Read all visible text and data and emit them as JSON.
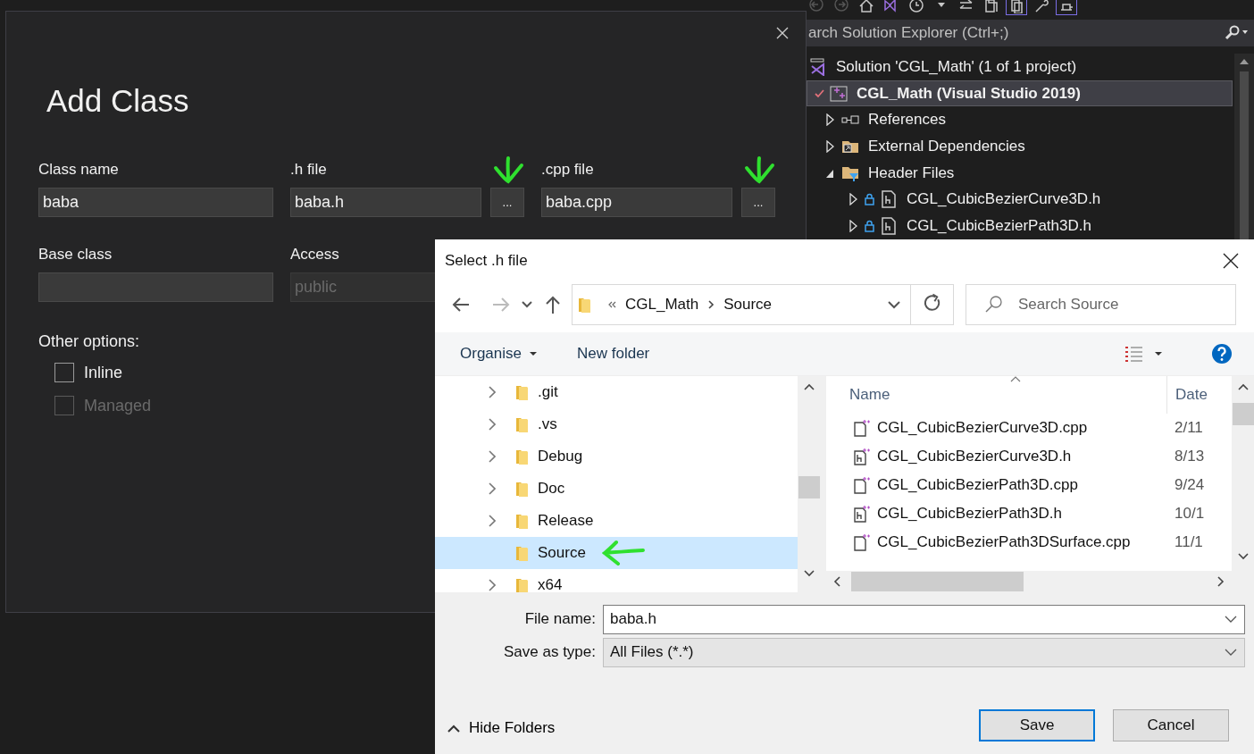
{
  "solution_explorer": {
    "search_placeholder": "arch Solution Explorer (Ctrl+;)",
    "tree": [
      {
        "label": "Solution 'CGL_Math' (1 of 1 project)",
        "kind": "solution",
        "selected": false,
        "startup": false,
        "children": [
          {
            "label": "CGL_Math (Visual Studio 2019)",
            "kind": "project",
            "selected": true,
            "startup": true,
            "checked_in": true,
            "children": [
              {
                "label": "References",
                "kind": "references",
                "selected": false,
                "startup": false,
                "expanded": false
              },
              {
                "label": "External Dependencies",
                "kind": "external",
                "selected": false,
                "startup": false,
                "expanded": false
              },
              {
                "label": "Header Files",
                "kind": "filter",
                "selected": false,
                "startup": false,
                "expanded": true,
                "children": [
                  {
                    "label": "CGL_CubicBezierCurve3D.h",
                    "kind": "header",
                    "selected": false,
                    "startup": false,
                    "locked": true,
                    "expanded": false
                  },
                  {
                    "label": "CGL_CubicBezierPath3D.h",
                    "kind": "header",
                    "selected": false,
                    "startup": false,
                    "locked": true,
                    "expanded": false
                  }
                ]
              }
            ]
          }
        ]
      }
    ]
  },
  "add_class_dialog": {
    "title": "Add Class",
    "fields": [
      {
        "label": "Class name",
        "value": "baba",
        "disabled": false
      },
      {
        "label": ".h file",
        "value": "baba.h",
        "disabled": false,
        "browse_label": "...",
        "annotated": true
      },
      {
        "label": ".cpp file",
        "value": "baba.cpp",
        "disabled": false,
        "browse_label": "...",
        "annotated": true
      },
      {
        "label": "Base class",
        "disabled": false
      },
      {
        "label": "Access",
        "value": "public",
        "disabled": true
      }
    ],
    "options_label": "Other options:",
    "options": [
      {
        "label": "Inline",
        "checked": false,
        "disabled": false
      },
      {
        "label": "Managed",
        "checked": false,
        "disabled": true
      }
    ]
  },
  "file_dialog": {
    "title": "Select .h file",
    "path": [
      "CGL_Math",
      "Source"
    ],
    "search_placeholder": "Search Source",
    "commands": [
      {
        "label": "Organise",
        "menu": true
      },
      {
        "label": "New folder",
        "menu": false
      }
    ],
    "folders": [
      {
        "name": ".git",
        "expandable": true,
        "selected": false,
        "annotated": false
      },
      {
        "name": ".vs",
        "expandable": true,
        "selected": false,
        "annotated": false
      },
      {
        "name": "Debug",
        "expandable": true,
        "selected": false,
        "annotated": false
      },
      {
        "name": "Doc",
        "expandable": true,
        "selected": false,
        "annotated": false
      },
      {
        "name": "Release",
        "expandable": true,
        "selected": false,
        "annotated": false
      },
      {
        "name": "Source",
        "expandable": false,
        "selected": true,
        "annotated": true
      },
      {
        "name": "x64",
        "expandable": true,
        "selected": false,
        "annotated": false
      }
    ],
    "columns": [
      "Name",
      "Date"
    ],
    "files": [
      {
        "name": "CGL_CubicBezierCurve3D.cpp",
        "kind": "cpp",
        "date": "2/11"
      },
      {
        "name": "CGL_CubicBezierCurve3D.h",
        "kind": "h",
        "date": "8/13"
      },
      {
        "name": "CGL_CubicBezierPath3D.cpp",
        "kind": "cpp",
        "date": "9/24"
      },
      {
        "name": "CGL_CubicBezierPath3D.h",
        "kind": "h",
        "date": "10/1"
      },
      {
        "name": "CGL_CubicBezierPath3DSurface.cpp",
        "kind": "cpp",
        "date": "11/1"
      }
    ],
    "file_name_label": "File name:",
    "file_name": "baba.h",
    "type_label": "Save as type:",
    "type_value": "All Files (*.*)",
    "hide_folders": "Hide Folders",
    "buttons": [
      {
        "label": "Save",
        "default": true
      },
      {
        "label": "Cancel",
        "default": false
      }
    ]
  }
}
